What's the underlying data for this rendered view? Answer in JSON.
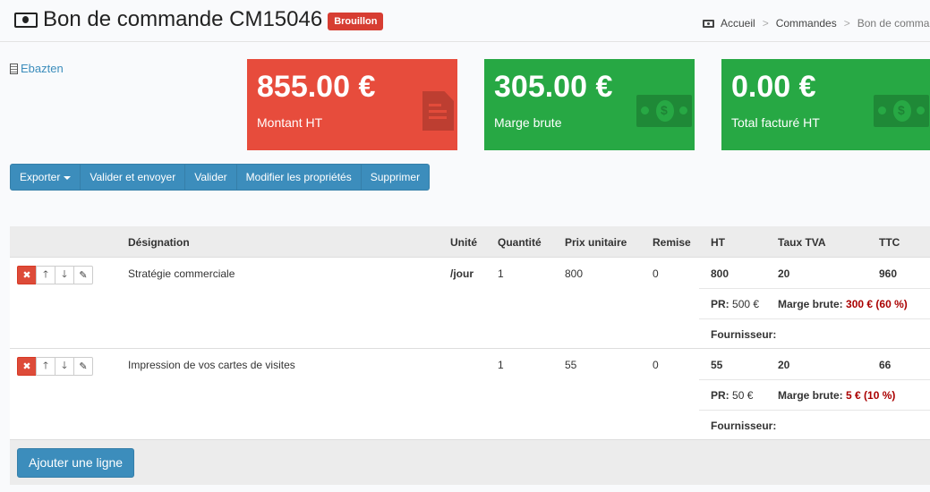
{
  "header": {
    "title": "Bon de commande CM15046",
    "status_badge": "Brouillon"
  },
  "breadcrumb": {
    "home": "Accueil",
    "orders": "Commandes",
    "current": "Bon de commande"
  },
  "company": {
    "name": "Ebazten"
  },
  "stats": [
    {
      "value": "855.00 €",
      "label": "Montant HT",
      "color": "#e74c3c",
      "icon": "document-icon"
    },
    {
      "value": "305.00 €",
      "label": "Marge brute",
      "color": "#27a844",
      "icon": "money-bill-icon"
    },
    {
      "value": "0.00 €",
      "label": "Total facturé HT",
      "color": "#27a844",
      "icon": "money-bill-icon"
    }
  ],
  "toolbar": {
    "export": "Exporter",
    "validate_send": "Valider et envoyer",
    "validate": "Valider",
    "edit_props": "Modifier les propriétés",
    "delete": "Supprimer"
  },
  "table": {
    "headers": {
      "designation": "Désignation",
      "unit": "Unité",
      "quantity": "Quantité",
      "unit_price": "Prix unitaire",
      "discount": "Remise",
      "ht": "HT",
      "vat_rate": "Taux TVA",
      "ttc": "TTC"
    },
    "rows": [
      {
        "designation": "Stratégie commerciale",
        "unit": "/jour",
        "quantity": "1",
        "unit_price": "800",
        "discount": "0",
        "ht": "800",
        "vat_rate": "20",
        "ttc": "960",
        "pr_label": "PR:",
        "pr_value": "500 €",
        "margin_label": "Marge brute:",
        "margin_value": "300 € (60 %)",
        "supplier_label": "Fournisseur:"
      },
      {
        "designation": "Impression de vos cartes de visites",
        "unit": "",
        "quantity": "1",
        "unit_price": "55",
        "discount": "0",
        "ht": "55",
        "vat_rate": "20",
        "ttc": "66",
        "pr_label": "PR:",
        "pr_value": "50 €",
        "margin_label": "Marge brute:",
        "margin_value": "5 € (10 %)",
        "supplier_label": "Fournisseur:"
      }
    ],
    "add_line": "Ajouter une ligne"
  }
}
